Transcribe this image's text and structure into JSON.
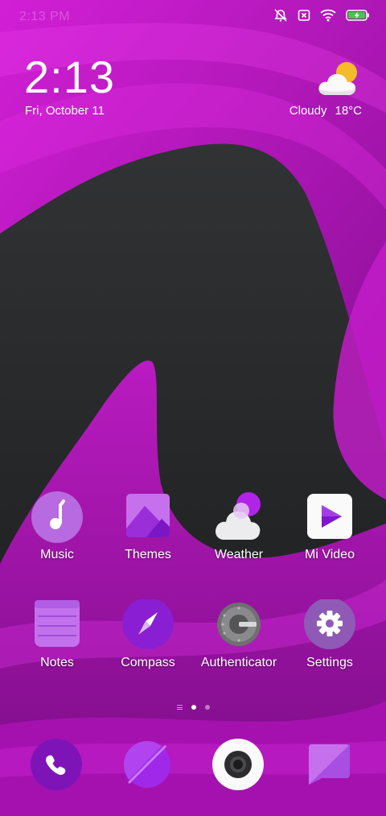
{
  "status_bar": {
    "time": "2:13 PM",
    "icons": [
      "alarm-off-icon",
      "no-sim-icon",
      "wifi-icon",
      "battery-charging-icon"
    ]
  },
  "lockwidget": {
    "time": "2:13",
    "date": "Fri, October 11"
  },
  "weather": {
    "condition": "Cloudy",
    "temperature": "18°C",
    "icon": "partly-cloudy-icon"
  },
  "apps_row1": [
    {
      "label": "Music",
      "icon": "music-note-icon"
    },
    {
      "label": "Themes",
      "icon": "themes-icon"
    },
    {
      "label": "Weather",
      "icon": "weather-cloud-icon"
    },
    {
      "label": "Mi Video",
      "icon": "play-icon"
    }
  ],
  "apps_row2": [
    {
      "label": "Notes",
      "icon": "notes-icon"
    },
    {
      "label": "Compass",
      "icon": "compass-icon"
    },
    {
      "label": "Authenticator",
      "icon": "authenticator-icon"
    },
    {
      "label": "Settings",
      "icon": "gear-icon"
    }
  ],
  "page_indicator": {
    "pages": 2,
    "current": 1
  },
  "dock": [
    "phone-icon",
    "browser-icon",
    "camera-icon",
    "messages-icon"
  ],
  "colors": {
    "accent": "#a020d0",
    "wallpaper_magenta": "#c418c8",
    "wallpaper_dark": "#2b2d2f"
  }
}
